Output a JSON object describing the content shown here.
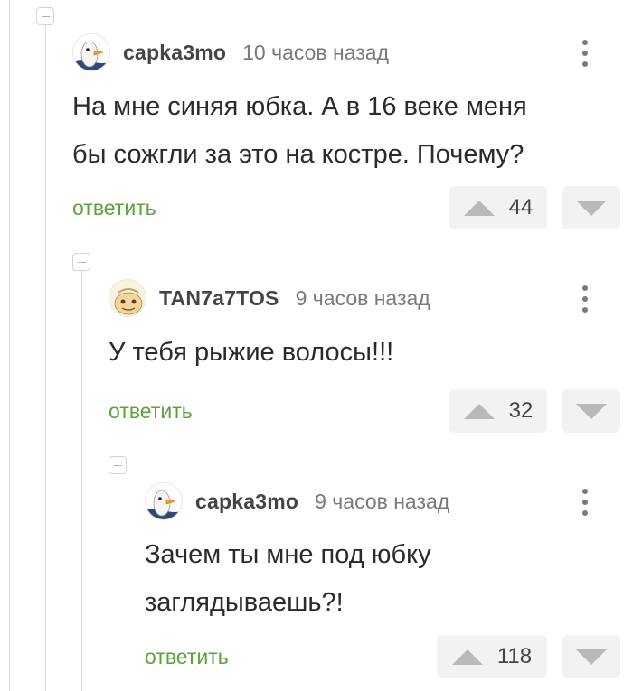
{
  "comments": [
    {
      "username": "capka3mo",
      "time": "10 часов назад",
      "text_lines": [
        "На мне синяя юбка. А в 16 веке меня",
        "бы сожгли за это на костре. Почему?"
      ],
      "reply_label": "ответить",
      "rating": "44",
      "avatar": "goose-avatar"
    },
    {
      "username": "TAN7a7TOS",
      "time": "9 часов назад",
      "text_lines": [
        "У тебя рыжие волосы!!!"
      ],
      "reply_label": "ответить",
      "rating": "32",
      "avatar": "cartoon-face-avatar"
    },
    {
      "username": "capka3mo",
      "time": "9 часов назад",
      "text_lines": [
        "Зачем ты мне под юбку",
        "заглядываешь?!"
      ],
      "reply_label": "ответить",
      "rating": "118",
      "avatar": "goose-avatar"
    }
  ],
  "colors": {
    "reply_green": "#5aa43a",
    "vote_bg": "#f2f2f2",
    "thread_line": "#dcdcdc"
  }
}
